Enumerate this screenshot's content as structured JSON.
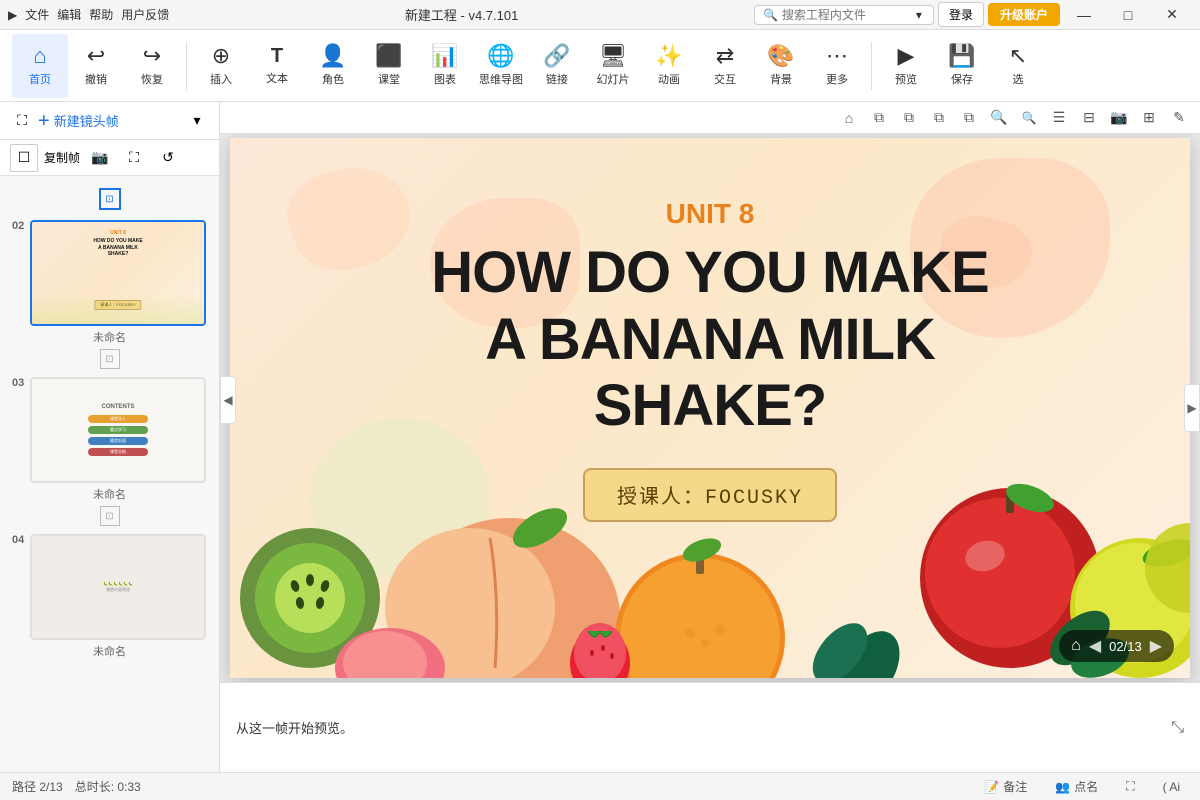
{
  "titlebar": {
    "app_icon": "▶",
    "menus": [
      "文件",
      "编辑",
      "帮助",
      "用户反馈"
    ],
    "title": "新建工程 - v4.7.101",
    "search_placeholder": "搜索工程内文件",
    "login_label": "登录",
    "upgrade_label": "升级账户",
    "minimize": "—",
    "maximize": "□",
    "close": "✕"
  },
  "toolbar": {
    "items": [
      {
        "id": "home",
        "icon": "⌂",
        "label": "首页"
      },
      {
        "id": "undo",
        "icon": "↩",
        "label": "撤销"
      },
      {
        "id": "redo",
        "icon": "↪",
        "label": "恢复"
      },
      {
        "id": "insert",
        "icon": "⊕",
        "label": "插入"
      },
      {
        "id": "text",
        "icon": "T",
        "label": "文本"
      },
      {
        "id": "role",
        "icon": "☺",
        "label": "角色"
      },
      {
        "id": "classroom",
        "icon": "▦",
        "label": "课堂"
      },
      {
        "id": "chart",
        "icon": "▮",
        "label": "图表"
      },
      {
        "id": "mindmap",
        "icon": "⊗",
        "label": "思维导图"
      },
      {
        "id": "link",
        "icon": "⛓",
        "label": "链接"
      },
      {
        "id": "slide",
        "icon": "▷",
        "label": "幻灯片"
      },
      {
        "id": "animation",
        "icon": "✦",
        "label": "动画"
      },
      {
        "id": "interact",
        "icon": "⇄",
        "label": "交互"
      },
      {
        "id": "bg",
        "icon": "▨",
        "label": "背景"
      },
      {
        "id": "more",
        "icon": "⋯",
        "label": "更多"
      },
      {
        "id": "preview",
        "icon": "▶",
        "label": "预览"
      },
      {
        "id": "save",
        "icon": "💾",
        "label": "保存"
      },
      {
        "id": "select",
        "icon": "↖",
        "label": "选"
      }
    ]
  },
  "sidebar": {
    "new_frame_label": "新建镜头帧",
    "copy_frame": "复制帧",
    "frames": [
      {
        "num": "02",
        "name": "未命名",
        "active": true
      },
      {
        "num": "03",
        "name": "未命名",
        "active": false
      },
      {
        "num": "04",
        "name": "未命名",
        "active": false
      }
    ]
  },
  "canvas_toolbar": {
    "tools": [
      "⌂",
      "⧉",
      "⧉",
      "⧉",
      "⧉",
      "🔍+",
      "🔍-",
      "☰",
      "⊟",
      "📷",
      "⊞",
      "✎"
    ]
  },
  "slide": {
    "unit": "UNIT 8",
    "title_line1": "HOW DO YOU MAKE",
    "title_line2": "A BANANA MILK",
    "title_line3": "SHAKE?",
    "teacher_label": "授课人：FOCUSKY",
    "nav": {
      "home": "⌂",
      "prev": "◀",
      "page": "02/13",
      "next": "▶"
    }
  },
  "notes": {
    "text": "从这一帧开始预览。",
    "expand_icon": "⤡"
  },
  "statusbar": {
    "path": "路径 2/13",
    "duration": "总时长: 0:33",
    "notes_label": "备注",
    "attendance_label": "点名",
    "fullscreen_icon": "⛶",
    "ai_label": "( Ai"
  }
}
